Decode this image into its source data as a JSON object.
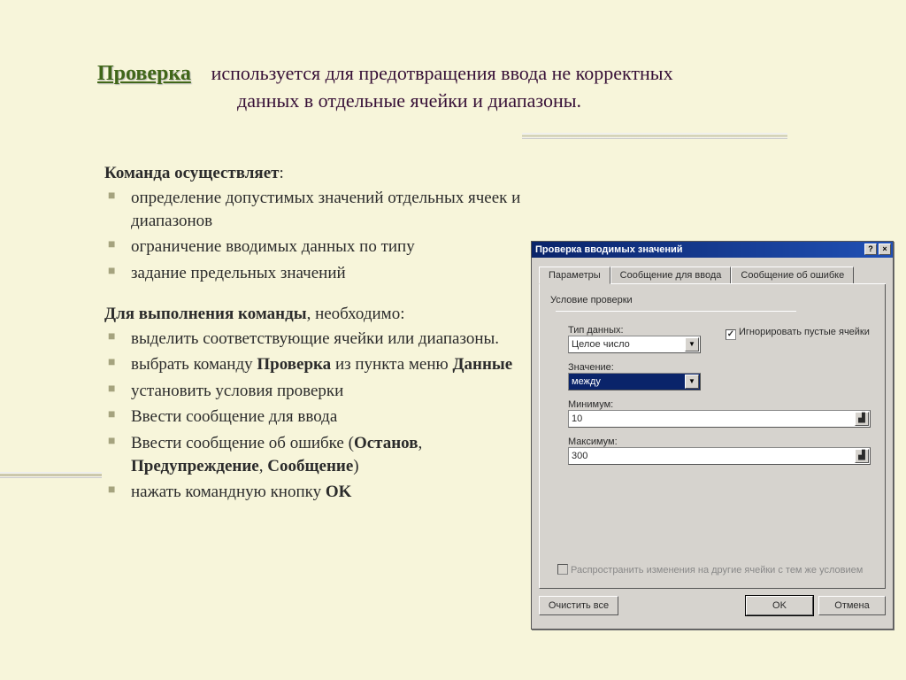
{
  "header": {
    "title": "Проверка",
    "desc_l1": "используется для предотвращения ввода не корректных",
    "desc_l2": "данных в отдельные ячейки и диапазоны."
  },
  "content": {
    "cmd_heading_prefix": "Команда осуществляет",
    "cmd_items": [
      " определение допустимых значений отдельных ячеек и   диапазонов",
      "ограничение вводимых данных по типу",
      "задание предельных значений"
    ],
    "exec_heading_prefix": "Для выполнения команды",
    "exec_heading_suffix": ", необходимо:",
    "exec_item_1": "выделить соответствующие ячейки или диапазоны.",
    "exec_item_2a": "выбрать команду ",
    "exec_item_2b": "Проверка",
    "exec_item_2c": " из пункта меню ",
    "exec_item_2d": "Данные",
    "exec_item_3": "установить условия проверки",
    "exec_item_4": "Ввести сообщение для ввода",
    "exec_item_5a": "Ввести сообщение об ошибке (",
    "exec_item_5b": "Останов",
    "exec_item_5c": ", ",
    "exec_item_5d": "Предупреждение",
    "exec_item_5e": ", ",
    "exec_item_5f": "Сообщение",
    "exec_item_5g": ")",
    "exec_item_6a": "нажать командную кнопку ",
    "exec_item_6b": "OK"
  },
  "dialog": {
    "title": "Проверка вводимых значений",
    "tabs": [
      "Параметры",
      "Сообщение для ввода",
      "Сообщение об ошибке"
    ],
    "group_label": "Условие проверки",
    "type_label": "Тип данных:",
    "type_value": "Целое число",
    "ignore_label": "Игнорировать пустые ячейки",
    "value_label": "Значение:",
    "value_value": "между",
    "min_label": "Минимум:",
    "min_value": "10",
    "max_label": "Максимум:",
    "max_value": "300",
    "propagate_label": "Распространить изменения на другие ячейки с тем же условием",
    "clear_btn": "Очистить все",
    "ok_btn": "OK",
    "cancel_btn": "Отмена",
    "help_glyph": "?",
    "close_glyph": "×",
    "down_glyph": "▼",
    "check_glyph": "✓"
  }
}
